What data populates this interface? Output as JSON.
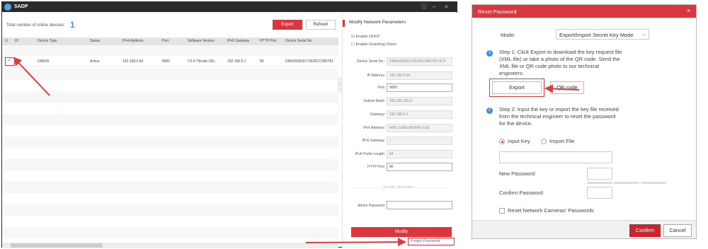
{
  "sadp": {
    "title": "SADP",
    "count_label": "Total number of online devices:",
    "count_value": "1",
    "export_label": "Export",
    "refresh_label": "Refresh",
    "columns": [
      "ID",
      "Device Type",
      "Status",
      "IPv4 Address",
      "Port",
      "Software Version",
      "IPv6 Gateway",
      "HTTP Port",
      "Device Serial No."
    ],
    "row": {
      "id": "001",
      "device_type": "DN81R",
      "status": "Active",
      "ipv4": "192.168.0.64",
      "port": "8000",
      "software_version": "V3.4.75build 180...",
      "ipv6_gateway": "192.168.0.1",
      "http_port": "80",
      "serial": "DN81R0820170628CCWR781"
    },
    "panel": {
      "title": "Modify Network Parameters",
      "enable_dhcp": "Enable DHCP",
      "enable_guarding": "Enable Guarding Vision",
      "fields": [
        {
          "label": "Device Serial No.:",
          "value": "DN81R0820170628CCWR7817473"
        },
        {
          "label": "IP Address:",
          "value": "192.168.0.64"
        },
        {
          "label": "Port:",
          "value": "8000"
        },
        {
          "label": "Subnet Mask:",
          "value": "255.255.255.0"
        },
        {
          "label": "Gateway:",
          "value": "192.168.0.1"
        },
        {
          "label": "IPv6 Address:",
          "value": "fe80::1a68:cbff:fe94:1ca6"
        },
        {
          "label": "IPv6 Gateway:",
          "value": "::"
        },
        {
          "label": "IPv6 Prefix Length:",
          "value": "64"
        },
        {
          "label": "HTTP Port:",
          "value": "80"
        }
      ],
      "security_label": "Security Verification",
      "admin_password_label": "Admin Password:",
      "modify_label": "Modify",
      "forgot_label": "Forgot Password"
    }
  },
  "dialog": {
    "title": "Reset Password",
    "close": "×",
    "mode_label": "Mode:",
    "mode_value": "Export/Import Secret Key Mode",
    "step1_num": "1",
    "step1_lines": [
      "Step 1: Click Export to download the key request file",
      "(XML file) or take a photo of the QR code. Send the",
      "XML file or QR code photo to our technical",
      "engineers."
    ],
    "export_label": "Export",
    "qr_label": "QR code",
    "step2_num": "2",
    "step2_lines": [
      "Step 2: Input the key or import the key file received",
      "from the technical engineer to reset the password",
      "for the device."
    ],
    "input_key": "Input Key",
    "import_file": "Import File",
    "new_password": "New Password:",
    "confirm_password": "Confirm Password:",
    "reset_cameras": "Reset Network Cameras' Passwords",
    "confirm": "Confirm",
    "cancel": "Cancel"
  },
  "colors": {
    "accent": "#d9363e",
    "highlight": "#e0393e",
    "blue": "#3a8ee6"
  }
}
